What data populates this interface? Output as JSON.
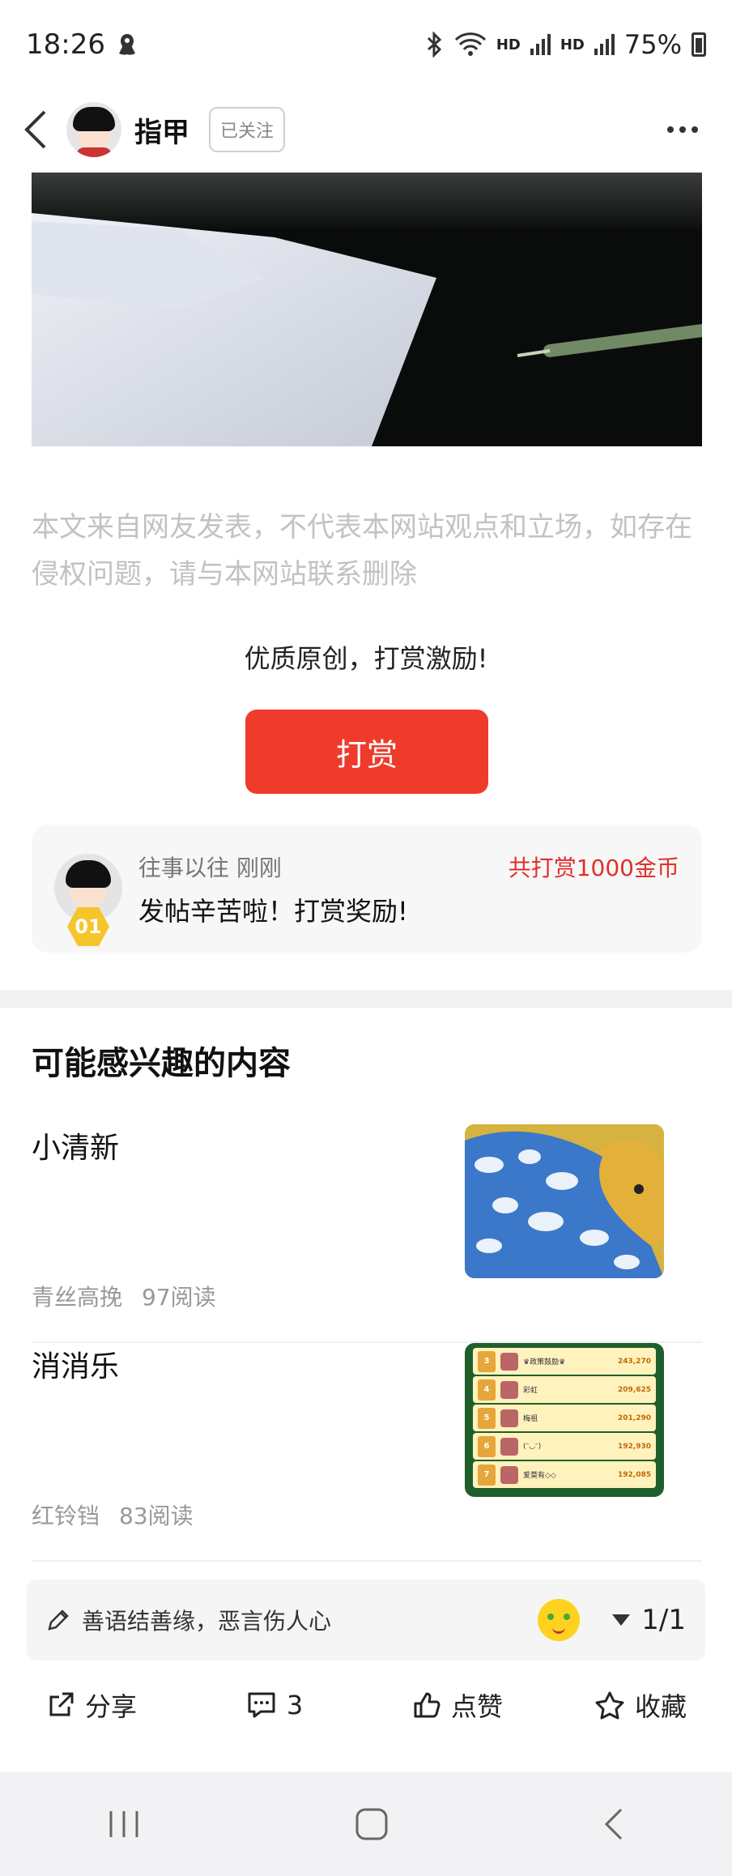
{
  "status_bar": {
    "time": "18:26",
    "battery": "75%",
    "network_1": "HD",
    "network_2": "HD"
  },
  "nav": {
    "author_name": "指甲",
    "follow_label": "已关注"
  },
  "article": {
    "disclaimer": "本文来自网友发表，不代表本网站观点和立场，如存在侵权问题，请与本网站联系删除"
  },
  "reward": {
    "tip": "优质原创，打赏激励!",
    "button_label": "打赏",
    "record": {
      "user": "往事以往",
      "time": "刚刚",
      "total": "共打赏1000金币",
      "message": "发帖辛苦啦！打赏奖励!",
      "rank_badge": "01"
    }
  },
  "recommendations": {
    "title": "可能感兴趣的内容",
    "items": [
      {
        "title": "小清新",
        "author": "青丝高挽",
        "reads": "97阅读"
      },
      {
        "title": "消消乐",
        "author": "红铃铛",
        "reads": "83阅读"
      }
    ]
  },
  "leaderboard_thumb": [
    {
      "rank": "3",
      "name": "♛政策鼓励♛",
      "score": "243,270"
    },
    {
      "rank": "4",
      "name": "彩虹",
      "score": "209,625"
    },
    {
      "rank": "5",
      "name": "梅祖",
      "score": "201,290"
    },
    {
      "rank": "6",
      "name": "(ᵔ◡ᵔ)",
      "score": "192,930"
    },
    {
      "rank": "7",
      "name": "爱莫有◇◇",
      "score": "192,085"
    }
  ],
  "comment": {
    "placeholder": "善语结善缘，恶言伤人心",
    "page_indicator": "1/1"
  },
  "actions": {
    "share": "分享",
    "comments_count": "3",
    "like": "点赞",
    "favorite": "收藏"
  },
  "colors": {
    "accent_red": "#ef3b2c",
    "reward_total_red": "#e0302a"
  }
}
